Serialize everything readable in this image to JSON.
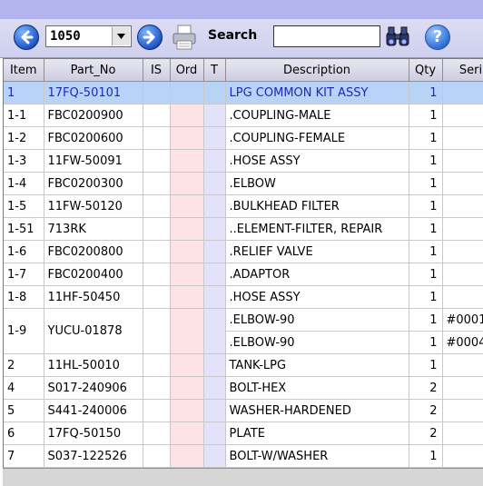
{
  "toolbar": {
    "record_value": "1050",
    "search_label": "Search",
    "search_value": "",
    "help_symbol": "?",
    "icons": [
      "back-arrow-icon",
      "forward-arrow-icon",
      "printer-icon",
      "binoculars-icon",
      "help-icon"
    ]
  },
  "table": {
    "headers": [
      "Item",
      "Part_No",
      "IS",
      "Ord",
      "T",
      "Description",
      "Qty",
      "Seri"
    ],
    "rows": [
      {
        "item": "1",
        "part_no": "17FQ-50101",
        "description": "LPG COMMON KIT ASSY",
        "qty": "1",
        "serial": ""
      },
      {
        "item": "1-1",
        "part_no": "FBC0200900",
        "description": ".COUPLING-MALE",
        "qty": "1",
        "serial": ""
      },
      {
        "item": "1-2",
        "part_no": "FBC0200600",
        "description": ".COUPLING-FEMALE",
        "qty": "1",
        "serial": ""
      },
      {
        "item": "1-3",
        "part_no": "11FW-50091",
        "description": ".HOSE ASSY",
        "qty": "1",
        "serial": ""
      },
      {
        "item": "1-4",
        "part_no": "FBC0200300",
        "description": ".ELBOW",
        "qty": "1",
        "serial": ""
      },
      {
        "item": "1-5",
        "part_no": "11FW-50120",
        "description": ".BULKHEAD FILTER",
        "qty": "1",
        "serial": ""
      },
      {
        "item": "1-51",
        "part_no": "713RK",
        "description": "..ELEMENT-FILTER, REPAIR",
        "qty": "1",
        "serial": ""
      },
      {
        "item": "1-6",
        "part_no": "FBC0200800",
        "description": ".RELIEF VALVE",
        "qty": "1",
        "serial": ""
      },
      {
        "item": "1-7",
        "part_no": "FBC0200400",
        "description": ".ADAPTOR",
        "qty": "1",
        "serial": ""
      },
      {
        "item": "1-8",
        "part_no": "11HF-50450",
        "description": ".HOSE ASSY",
        "qty": "1",
        "serial": ""
      },
      {
        "item": "1-9",
        "part_no": "YUCU-01878",
        "description": ".ELBOW-90",
        "qty": "1",
        "serial": "#0001"
      },
      {
        "item": "",
        "part_no": "",
        "description": ".ELBOW-90",
        "qty": "1",
        "serial": "#0004"
      },
      {
        "item": "2",
        "part_no": "11HL-50010",
        "description": "TANK-LPG",
        "qty": "1",
        "serial": ""
      },
      {
        "item": "4",
        "part_no": "S017-240906",
        "description": "BOLT-HEX",
        "qty": "2",
        "serial": ""
      },
      {
        "item": "5",
        "part_no": "S441-240006",
        "description": "WASHER-HARDENED",
        "qty": "2",
        "serial": ""
      },
      {
        "item": "6",
        "part_no": "17FQ-50150",
        "description": "PLATE",
        "qty": "2",
        "serial": ""
      },
      {
        "item": "7",
        "part_no": "S037-122526",
        "description": "BOLT-W/WASHER",
        "qty": "1",
        "serial": ""
      }
    ]
  },
  "colors": {
    "selected_row_bg": "#b7d3f8",
    "selected_row_text": "#1d28b8",
    "ord_column_bg": "#fde2e6",
    "t_column_bg": "#e3e2fa"
  }
}
